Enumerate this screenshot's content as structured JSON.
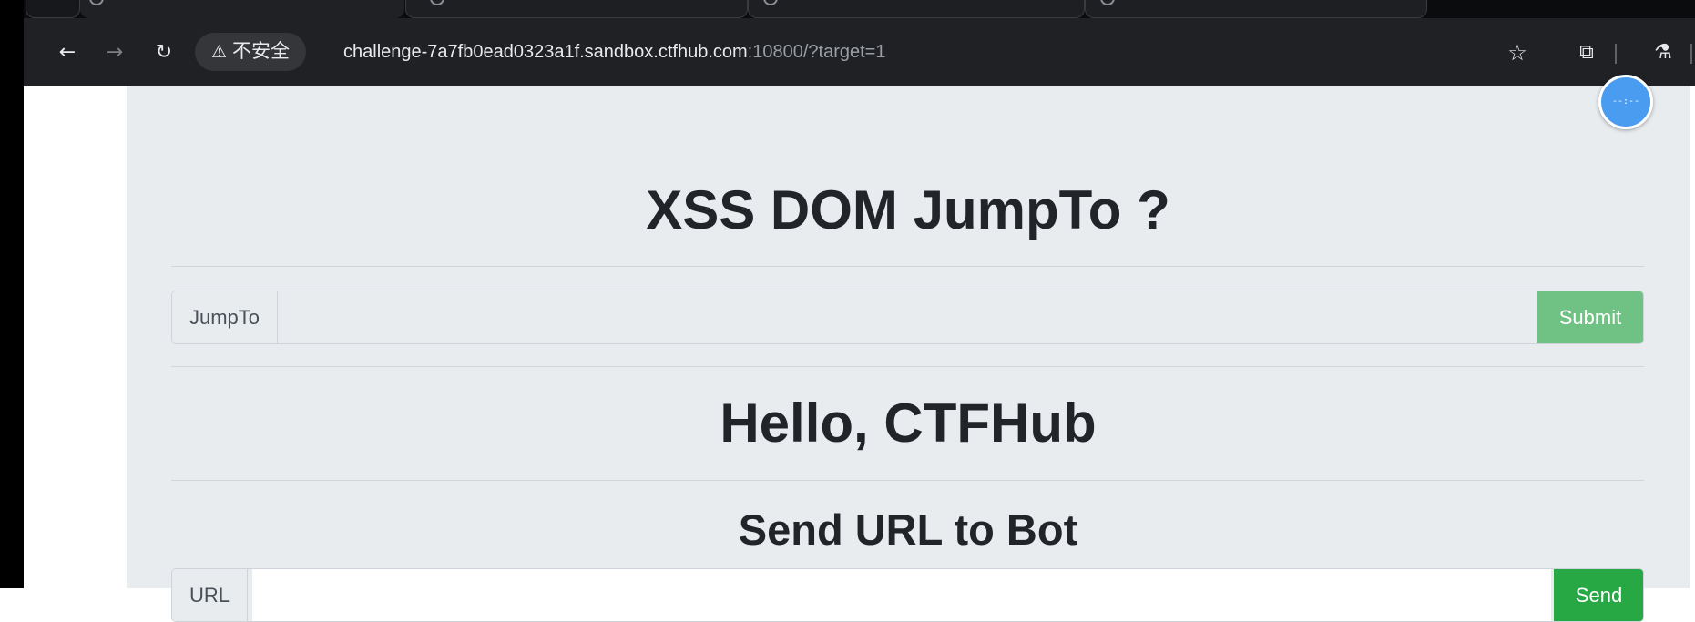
{
  "browser": {
    "security_label": "不安全",
    "security_icon": "warning-triangle-icon",
    "url_host": "challenge-7a7fb0ead0323a1f.sandbox.ctfhub.com",
    "url_rest": ":10800/?target=1",
    "back_icon": "←",
    "forward_icon": "→",
    "reload_icon": "↻",
    "star_icon": "☆",
    "extensions_icon": "⧉",
    "labs_icon": "⚗"
  },
  "page": {
    "title": "XSS DOM JumpTo ?",
    "jump_label": "JumpTo",
    "jump_value": "",
    "submit_label": "Submit",
    "hello": "Hello, CTFHub",
    "send_heading": "Send URL to Bot",
    "url_label": "URL",
    "send_label": "Send"
  },
  "bubble": {
    "text": "--:--"
  },
  "colors": {
    "toolbar": "#202124",
    "jumbotron": "#e9ecef",
    "submit": "#6fc283",
    "send": "#28a745",
    "bubble": "#4a9cf0"
  }
}
